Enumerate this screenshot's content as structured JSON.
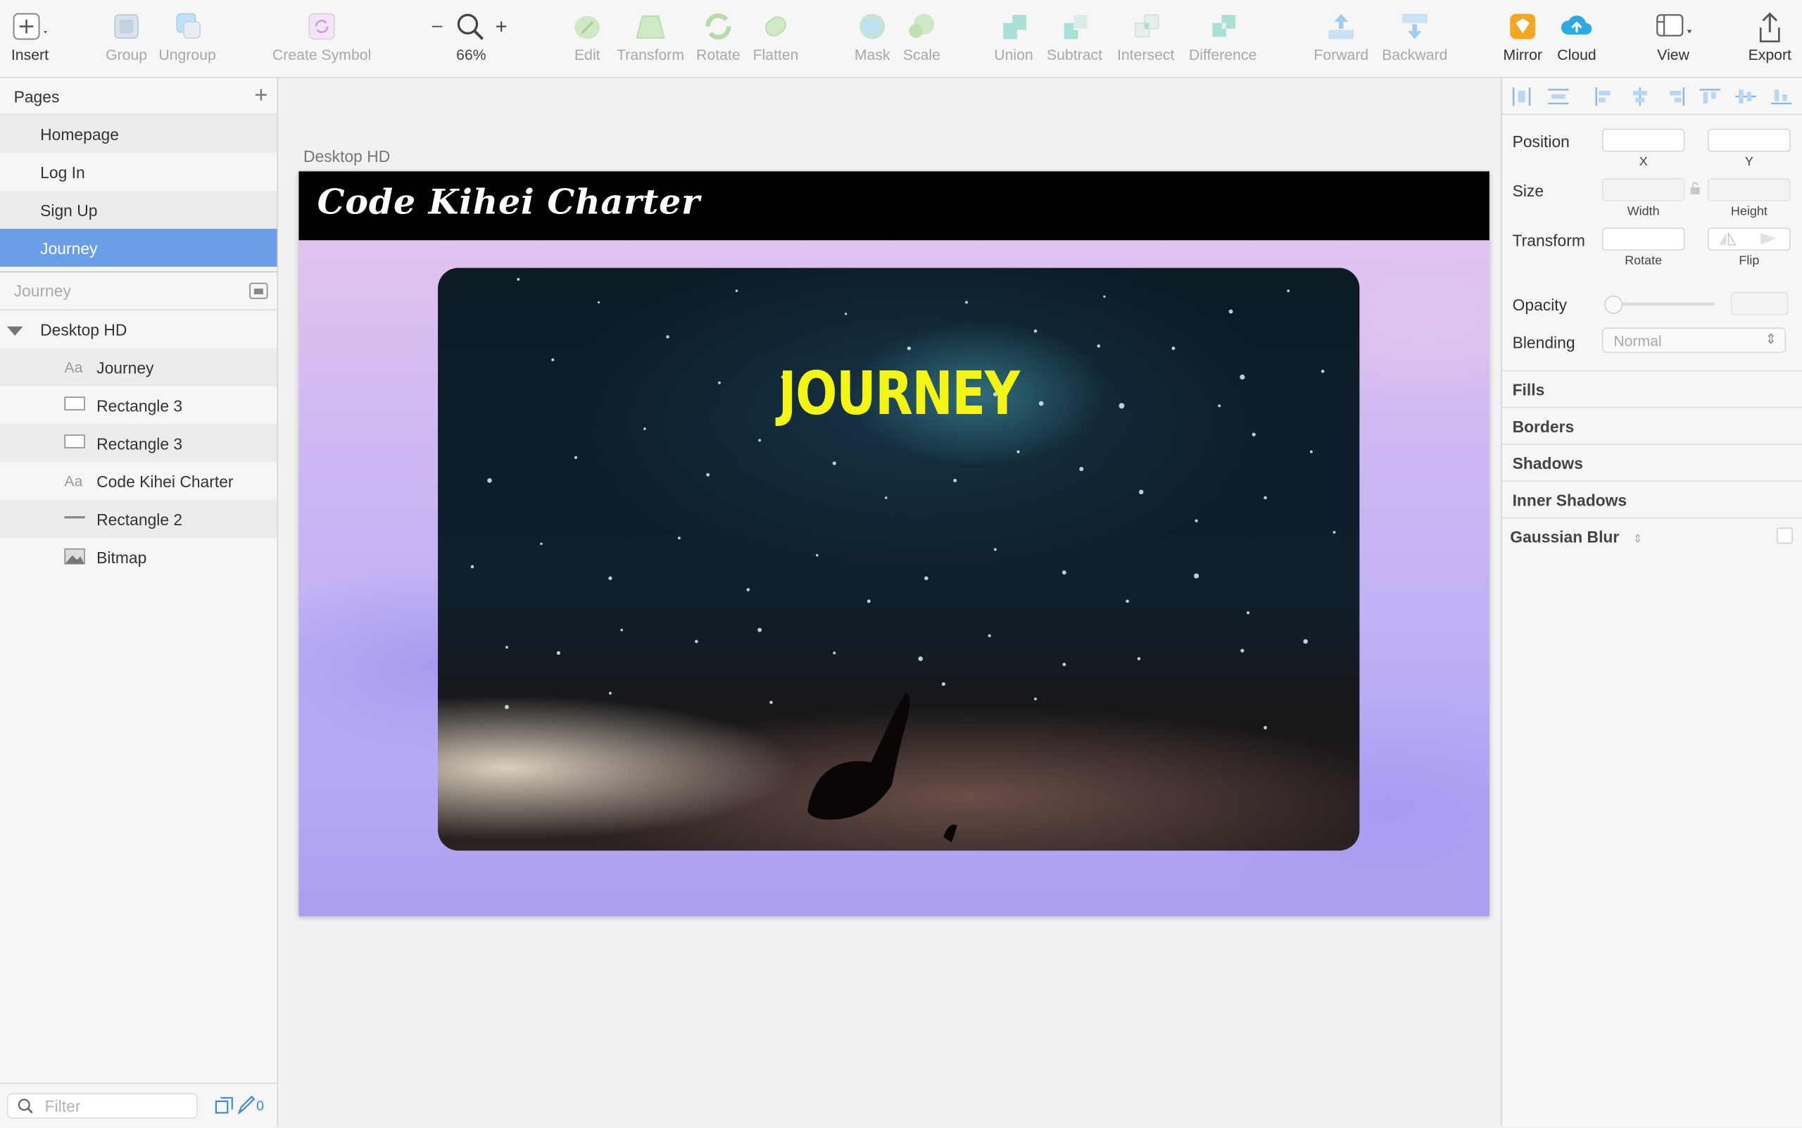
{
  "toolbar": {
    "insert": "Insert",
    "group": "Group",
    "ungroup": "Ungroup",
    "create_symbol": "Create Symbol",
    "zoom_minus": "–",
    "zoom_plus": "+",
    "zoom": "66%",
    "edit": "Edit",
    "transform": "Transform",
    "rotate": "Rotate",
    "flatten": "Flatten",
    "mask": "Mask",
    "scale": "Scale",
    "union": "Union",
    "subtract": "Subtract",
    "intersect": "Intersect",
    "difference": "Difference",
    "forward": "Forward",
    "backward": "Backward",
    "mirror": "Mirror",
    "cloud": "Cloud",
    "view": "View",
    "export": "Export"
  },
  "pages": {
    "title": "Pages",
    "add_icon": "plus-icon",
    "items": [
      {
        "label": "Homepage"
      },
      {
        "label": "Log In"
      },
      {
        "label": "Sign Up"
      },
      {
        "label": "Journey"
      }
    ],
    "selected": "Journey"
  },
  "layers": {
    "search_value": "Journey",
    "group": "Desktop HD",
    "items": [
      {
        "icon": "Aa",
        "label": "Journey"
      },
      {
        "icon": "rectangle-icon",
        "label": "Rectangle 3"
      },
      {
        "icon": "rectangle-icon",
        "label": "Rectangle 3"
      },
      {
        "icon": "Aa",
        "label": "Code Kihei Charter"
      },
      {
        "icon": "line-icon",
        "label": "Rectangle 2"
      },
      {
        "icon": "bitmap-icon",
        "label": "Bitmap"
      }
    ],
    "filter_placeholder": "Filter",
    "filter_count": "0"
  },
  "canvas": {
    "artboard_label": "Desktop HD",
    "header_title": "Code Kihei Charter",
    "photo_title": "JOURNEY"
  },
  "inspector": {
    "position": "Position",
    "x": "X",
    "y": "Y",
    "size": "Size",
    "width": "Width",
    "height": "Height",
    "transform": "Transform",
    "rotate": "Rotate",
    "flip": "Flip",
    "opacity": "Opacity",
    "blending": "Blending",
    "blending_value": "Normal",
    "sections": [
      "Fills",
      "Borders",
      "Shadows",
      "Inner Shadows",
      "Gaussian Blur"
    ]
  },
  "colors": {
    "selection": "#6a9ee8",
    "photo_title": "#f5f514",
    "header_bg": "#000000"
  }
}
